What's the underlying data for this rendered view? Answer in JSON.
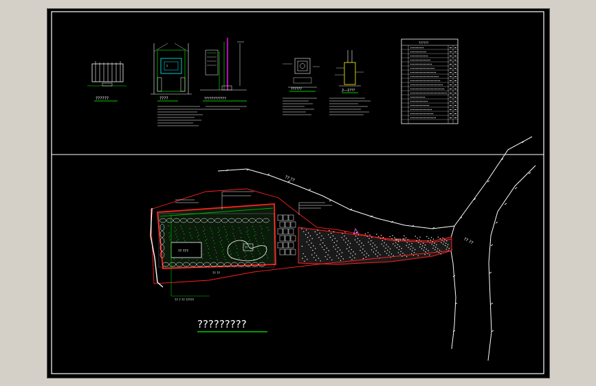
{
  "drawing": {
    "background": "#000000",
    "frame_color": "#ffffff",
    "accent_colors": {
      "boundary_red": "#ff2020",
      "title_underline_green": "#00cc00",
      "detail_cyan": "#00ffff",
      "detail_magenta": "#ff00ff",
      "detail_yellow": "#ffff00",
      "vegetation_green": "#00aa00"
    },
    "plan_title": "?????????",
    "detail_titles": {
      "fence_elevation": "??????",
      "gate_elevation": "????",
      "post_elevation": "????????????",
      "footing_plan": "??????",
      "section_2": "2—2???"
    },
    "road_labels": {
      "upper_road": "?? ??",
      "right_road": "?? ??"
    },
    "site_labels": {
      "building_block": "?? ???",
      "leader_note": "?? ? ?? ?????",
      "entrance_note": "???? ??",
      "pond_label": "??",
      "south_note": "?? ??"
    },
    "material_table": {
      "header": "??????",
      "rows": 18
    }
  }
}
